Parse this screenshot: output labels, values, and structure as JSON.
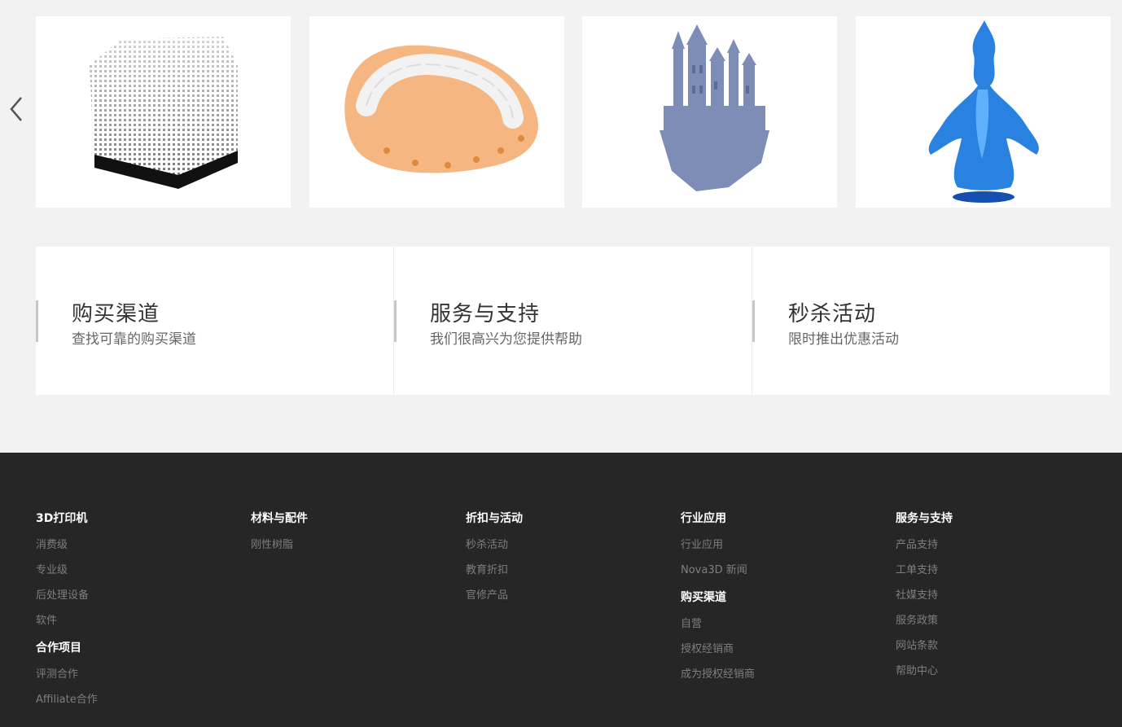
{
  "carousel": {
    "prev_icon": "chevron-left-icon",
    "slides": [
      {
        "name": "lattice-cube-model"
      },
      {
        "name": "dental-model"
      },
      {
        "name": "castle-model"
      },
      {
        "name": "blue-figure-model"
      }
    ]
  },
  "features": [
    {
      "title": "购买渠道",
      "desc": "查找可靠的购买渠道"
    },
    {
      "title": "服务与支持",
      "desc": "我们很高兴为您提供帮助"
    },
    {
      "title": "秒杀活动",
      "desc": "限时推出优惠活动"
    }
  ],
  "footer": {
    "col1": {
      "heading": "3D打印机",
      "links": [
        "消费级",
        "专业级",
        "后处理设备",
        "软件"
      ],
      "heading2": "合作项目",
      "links2": [
        "评测合作",
        "Affiliate合作"
      ]
    },
    "col2": {
      "heading": "材料与配件",
      "links": [
        "刚性树脂"
      ]
    },
    "col3": {
      "heading": "折扣与活动",
      "links": [
        "秒杀活动",
        "教育折扣",
        "官修产品"
      ]
    },
    "col4": {
      "heading": "行业应用",
      "links": [
        "行业应用",
        "Nova3D 新闻"
      ],
      "heading2": "购买渠道",
      "links2": [
        "自营",
        "授权经销商",
        "成为授权经销商"
      ]
    },
    "col5": {
      "heading": "服务与支持",
      "links": [
        "产品支持",
        "工单支持",
        "社媒支持",
        "服务政策",
        "网站条款",
        "帮助中心"
      ]
    }
  },
  "colors": {
    "footer_bg": "#262626",
    "page_bg": "#f2f2f2",
    "link": "#7e7e7e"
  }
}
